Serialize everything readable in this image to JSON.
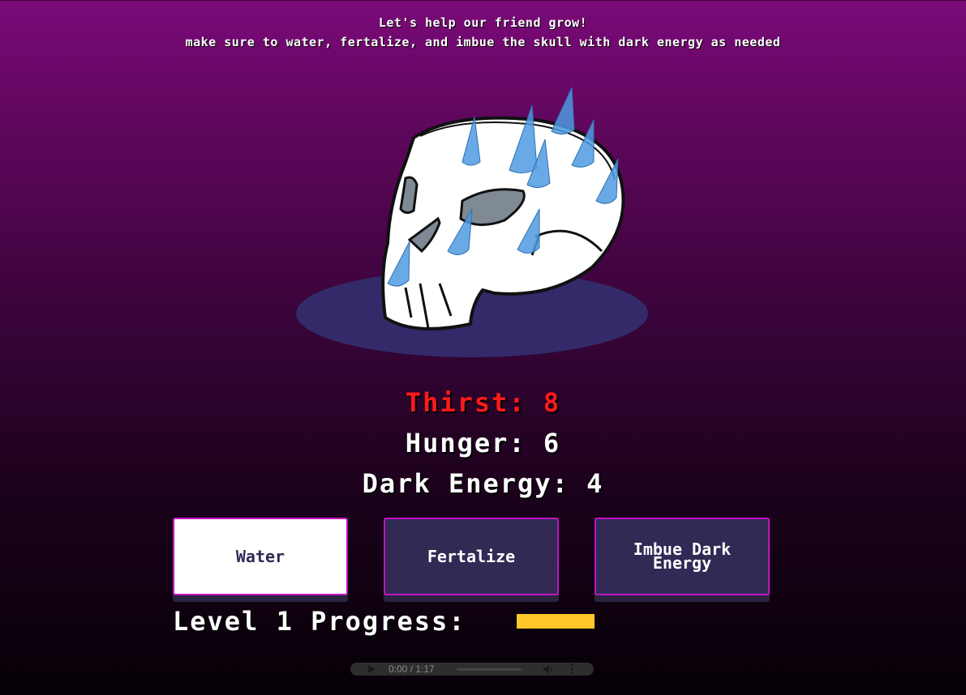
{
  "intro": {
    "line1": "Let's help our friend grow!",
    "line2": "make sure to water, fertalize, and imbue the skull with dark energy as needed"
  },
  "stats": {
    "thirst_label": "Thirst: 8",
    "thirst_value": 8,
    "hunger_label": "Hunger: 6",
    "hunger_value": 6,
    "dark_label": "Dark Energy: 4",
    "dark_value": 4
  },
  "buttons": {
    "water": "Water",
    "fertalize": "Fertalize",
    "imbue": "Imbue Dark Energy"
  },
  "progress": {
    "label": "Level 1 Progress:",
    "fill_fraction": 0.2
  },
  "audio": {
    "time": "0:00 / 1:17"
  },
  "colors": {
    "thirst_alert": "#ff1a1a",
    "button_dark": "#302a55",
    "button_border": "#c214c2",
    "progress_fill": "#ffc72a",
    "shadow_ellipse": "#342a6a",
    "drop": "#4f9ae0"
  },
  "icons": {
    "skull": "skull-character",
    "drops": "water-drop-icon",
    "play": "play-icon",
    "volume": "volume-icon",
    "more": "more-vert-icon"
  }
}
